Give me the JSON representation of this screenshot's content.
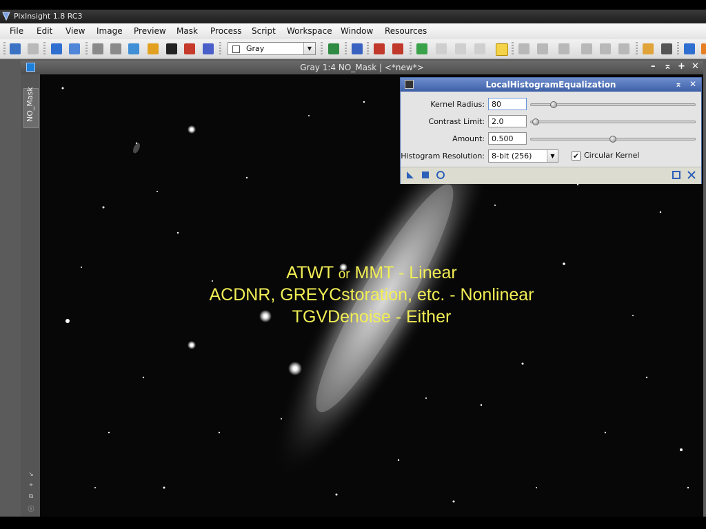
{
  "app": {
    "title": "PixInsight 1.8 RC3"
  },
  "menu": [
    "File",
    "Edit",
    "View",
    "Image",
    "Preview",
    "Mask",
    "Process",
    "Script",
    "Workspace",
    "Window",
    "Resources"
  ],
  "toolbar": {
    "colorspace_value": "Gray"
  },
  "image_window": {
    "title": "Gray 1:4 NO_Mask | <*new*>",
    "side_tab": "NO_Mask",
    "overlay_lines": [
      {
        "a": "ATWT ",
        "b": "or",
        "c": " MMT - Linear"
      },
      {
        "a": "ACDNR, GREYCstoration, etc. - Nonlinear",
        "b": "",
        "c": ""
      },
      {
        "a": "TGVDenoise - Either",
        "b": "",
        "c": ""
      }
    ]
  },
  "process_panel": {
    "title": "LocalHistogramEqualization",
    "kernel_radius": {
      "label": "Kernel Radius:",
      "value": "80",
      "slider_fraction": 0.14
    },
    "contrast_limit": {
      "label": "Contrast Limit:",
      "value": "2.0",
      "slider_fraction": 0.03
    },
    "amount": {
      "label": "Amount:",
      "value": "0.500",
      "slider_fraction": 0.5
    },
    "histogram_resolution": {
      "label": "Histogram Resolution:",
      "value": "8-bit (256)"
    },
    "circular_kernel": {
      "label": "Circular Kernel",
      "checked": true
    }
  }
}
